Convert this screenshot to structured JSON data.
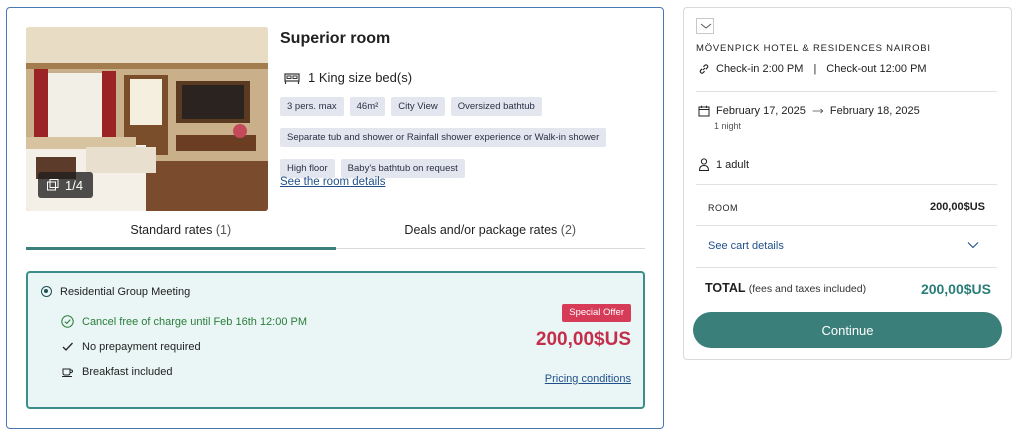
{
  "room": {
    "title": "Superior room",
    "bed": "1 King size bed(s)",
    "photo_counter": "1/4",
    "chips_row1": [
      "3 pers. max",
      "46m²",
      "City View",
      "Oversized bathtub"
    ],
    "chips_row2": [
      "Separate tub and shower or Rainfall shower experience or Walk-in shower"
    ],
    "chips_row3": [
      "High floor",
      "Baby's bathtub on request"
    ],
    "details_link": "See the room details"
  },
  "tabs": [
    {
      "label": "Standard rates",
      "count": "(1)"
    },
    {
      "label": "Deals and/or package rates",
      "count": "(2)"
    }
  ],
  "rate": {
    "name": "Residential Group Meeting",
    "cancel": "Cancel free of charge until Feb 16th 12:00 PM",
    "prepay": "No prepayment required",
    "breakfast": "Breakfast included",
    "offer_badge": "Special Offer",
    "price": "200,00$US",
    "pricing_link": "Pricing conditions"
  },
  "summary": {
    "hotel": "MÖVENPICK HOTEL & RESIDENCES NAIROBI",
    "checkin": "Check-in 2:00 PM",
    "divider": "|",
    "checkout": "Check-out 12:00 PM",
    "date_from": "February 17, 2025",
    "date_to": "February 18, 2025",
    "nights": "1 night",
    "guests": "1 adult",
    "room_label": "ROOM",
    "room_value": "200,00$US",
    "cart_link": "See cart details",
    "total_label": "TOTAL",
    "total_note": "(fees and taxes included)",
    "total_value": "200,00$US",
    "continue_label": "Continue"
  },
  "colors": {
    "accent": "#3a7f7a",
    "price_red": "#c42e4a",
    "offer_red": "#d63b58",
    "link_blue": "#1f4f8a",
    "card_border": "#4a78b5"
  }
}
